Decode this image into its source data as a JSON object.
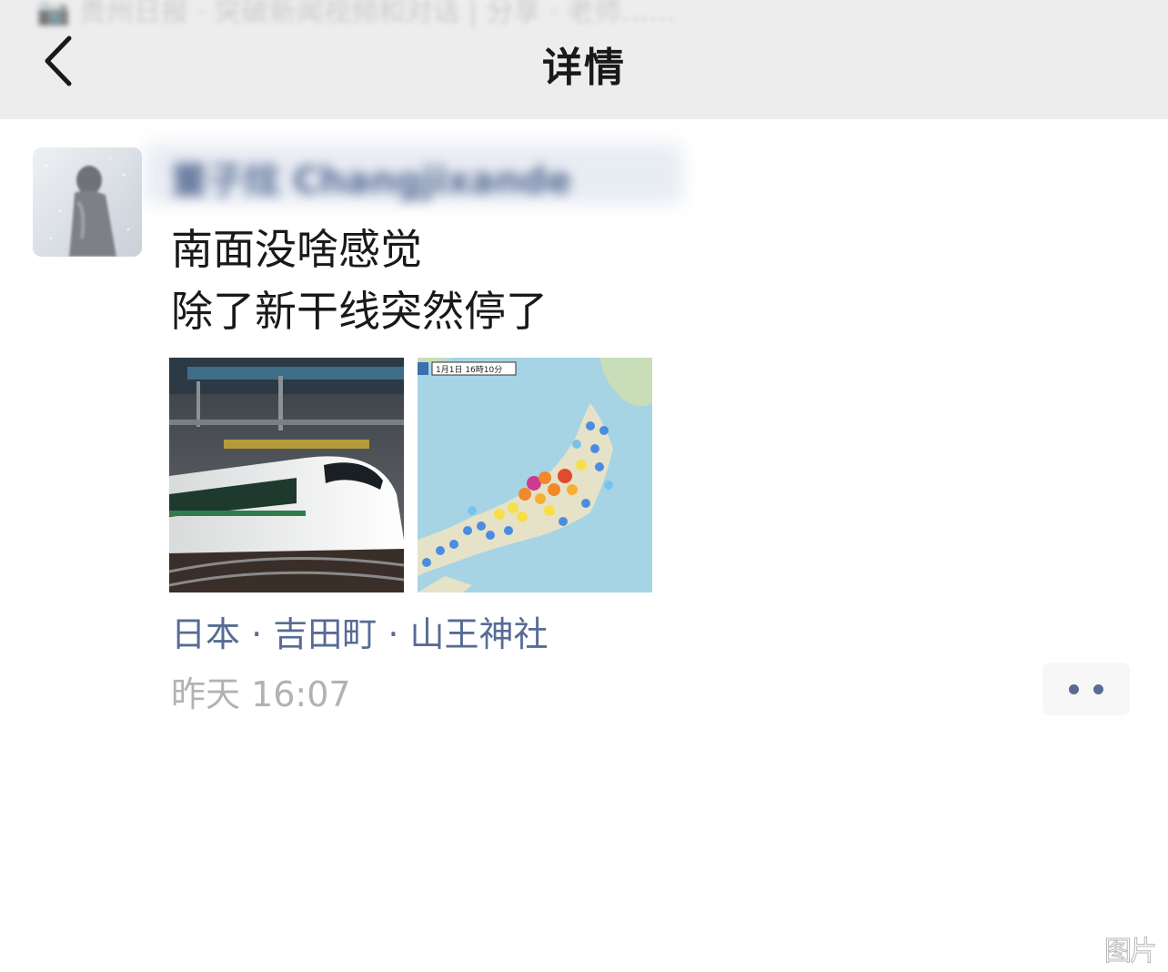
{
  "nav": {
    "ghost_text": "📷 贵州日报 · 突破新闻视频和对话 | 分享 · 老师……",
    "title": "详情",
    "back_icon": "chevron-left-icon"
  },
  "post": {
    "author_name": "董子炫 Changjixande",
    "text_lines": [
      "南面没啥感觉",
      "除了新干线突然停了"
    ],
    "images": [
      {
        "label": "shinkansen-train-photo"
      },
      {
        "label": "japan-earthquake-intensity-map",
        "map_caption": "1月1日 16時10分"
      }
    ],
    "location": "日本 · 吉田町 · 山王神社",
    "timestamp": "昨天 16:07",
    "more_icon": "more-dots-icon"
  },
  "colors": {
    "nav_bg": "#ededed",
    "link": "#576b95",
    "text": "#191919",
    "meta": "#b2b2b2"
  },
  "watermark": "图片"
}
